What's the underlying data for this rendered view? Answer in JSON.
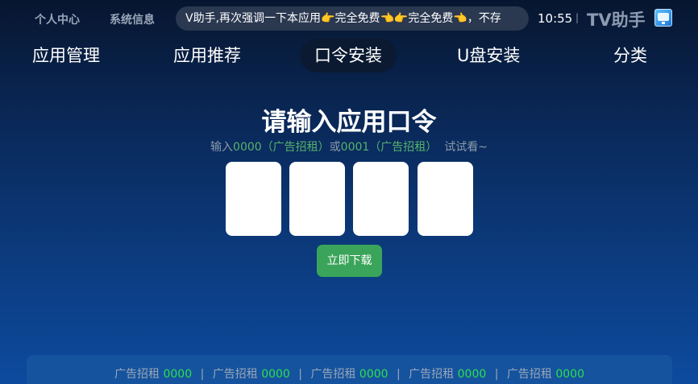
{
  "header": {
    "links": [
      "个人中心",
      "系统信息"
    ],
    "marquee": "V助手,再次强调一下本应用👉完全免费👈👉完全免费👈，不存",
    "clock": "10:55",
    "separator": "|",
    "brand": "TV助手",
    "brand_icon": "tv-app-icon"
  },
  "tabs": [
    {
      "label": "应用管理",
      "active": false
    },
    {
      "label": "应用推荐",
      "active": false
    },
    {
      "label": "口令安装",
      "active": true
    },
    {
      "label": "U盘安装",
      "active": false
    },
    {
      "label": "分类",
      "active": false
    }
  ],
  "main": {
    "title": "请输入应用口令",
    "hint_prefix": "输入",
    "hint_code1": "0000（广告招租）",
    "hint_mid": "或",
    "hint_code2": "0001（广告招租）",
    "hint_suffix": "  试试看~",
    "code_boxes": [
      "",
      "",
      "",
      ""
    ],
    "download_label": "立即下载"
  },
  "ads": [
    {
      "label": "广告招租",
      "code": "0000"
    },
    {
      "label": "广告招租",
      "code": "0000"
    },
    {
      "label": "广告招租",
      "code": "0000"
    },
    {
      "label": "广告招租",
      "code": "0000"
    },
    {
      "label": "广告招租",
      "code": "0000"
    }
  ],
  "colors": {
    "accent_green": "#3aa55a",
    "code_green": "#2be04f",
    "active_tab_bg": "#0b1a31"
  }
}
